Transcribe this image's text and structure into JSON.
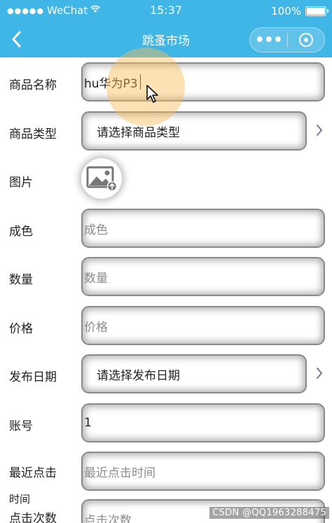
{
  "status_bar": {
    "carrier": "WeChat",
    "time": "15:37",
    "battery": "100%"
  },
  "nav": {
    "title": "跳蚤市场"
  },
  "form": {
    "name": {
      "label": "商品名称",
      "value": "hu华为P3"
    },
    "type": {
      "label": "商品类型",
      "select_text": "请选择商品类型"
    },
    "image": {
      "label": "图片"
    },
    "condition": {
      "label": "成色",
      "placeholder": "成色"
    },
    "quantity": {
      "label": "数量",
      "placeholder": "数量"
    },
    "price": {
      "label": "价格",
      "placeholder": "价格"
    },
    "date": {
      "label": "发布日期",
      "select_text": "请选择发布日期"
    },
    "account": {
      "label": "账号",
      "value": "1"
    },
    "last_click": {
      "label": "最近点击",
      "label_line2": "时间",
      "placeholder": "最近点击时间"
    },
    "click_count": {
      "label": "点击次数",
      "placeholder": "点击次数"
    }
  },
  "watermark": "CSDN @QQ1963288475",
  "colors": {
    "header_bg": "#3fb6e6",
    "highlight": "#f6bd58"
  },
  "icons": [
    "back-chevron",
    "more-dots",
    "close-circle",
    "image-upload",
    "chevron-right",
    "mouse-cursor"
  ]
}
